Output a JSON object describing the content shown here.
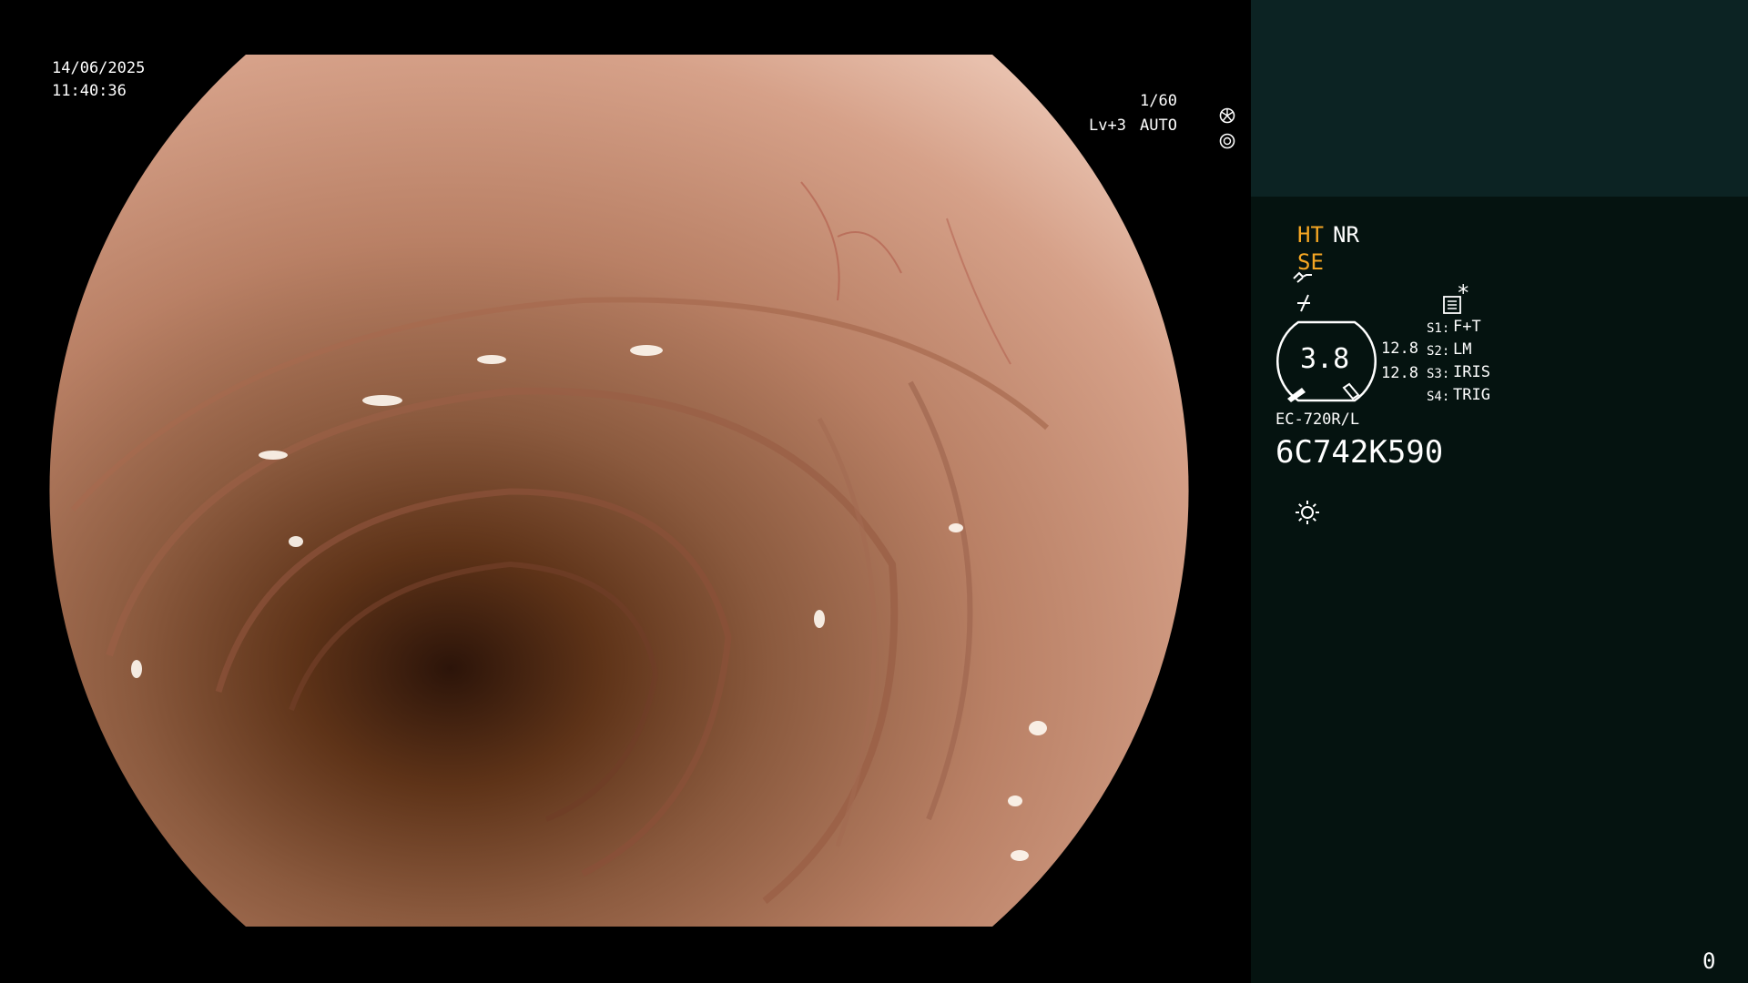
{
  "overlay": {
    "date": "14/06/2025",
    "time": "11:40:36",
    "shutter": "1/60",
    "shutter_icon": "aperture-icon",
    "light_level": "Lv+3",
    "light_mode": "AUTO",
    "light_mode_icon": "iris-icon"
  },
  "panel": {
    "mode_ht": "HT",
    "mode_nr": "NR",
    "mode_se": "SE",
    "enhance_icon": "structure-enhance-icon",
    "freeze_icon": "freeze-icon",
    "memo_icon": "memo-icon",
    "star_label": "*",
    "gauge_value": "3.8",
    "value_1": "12.8",
    "value_2": "12.8",
    "switches": [
      {
        "key": "S1:",
        "value": "F+T"
      },
      {
        "key": "S2:",
        "value": "LM"
      },
      {
        "key": "S3:",
        "value": "IRIS"
      },
      {
        "key": "S4:",
        "value": "TRIG"
      }
    ],
    "scope_model": "EC-720R/L",
    "scope_serial": "6C742K590",
    "light_icon": "sun-icon",
    "counter": "0"
  },
  "colors": {
    "panel_bg": "#051310",
    "panel_top_bg": "#0c2323",
    "accent_orange": "#f5a623",
    "text": "#ffffff"
  }
}
